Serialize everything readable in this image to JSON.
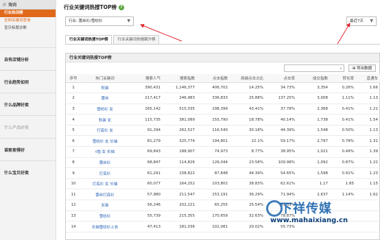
{
  "sidebar": {
    "header": "淘词",
    "sub_items": [
      {
        "label": "行业热词榜",
        "state": "active"
      },
      {
        "label": "全网关键词查询",
        "state": "orange"
      },
      {
        "label": "宝贝标题诊断",
        "state": "normal"
      }
    ],
    "sections": [
      {
        "label": "自有店铺分析",
        "dim": false
      },
      {
        "label": "行业趋势如何",
        "dim": false
      },
      {
        "label": "什么品牌好卖",
        "dim": false
      },
      {
        "label": "什么产品好卖",
        "dim": true
      },
      {
        "label": "谁家卖得好",
        "dim": false
      },
      {
        "label": "什么宝贝好卖",
        "dim": false
      }
    ]
  },
  "page": {
    "title": "行业关键词热搜TOP榜",
    "help_icon": "?",
    "industry_select": "行业: 蕾丝衫/雪纺衫",
    "period_select": "最近7天",
    "tabs": [
      {
        "label": "行业关键词热搜TOP榜",
        "active": true
      },
      {
        "label": "行业关键词热搜飙升榜",
        "active": false
      }
    ],
    "panel_title": "行业关键词热搜TOP榜",
    "search_placeholder": "",
    "export_label": "导出数据",
    "columns": [
      "序号",
      "热门关键词",
      "搜索人气",
      "搜索指数",
      "点击指数",
      "商城点击占比",
      "点击率",
      "成交指数",
      "转化率",
      "直通车"
    ]
  },
  "rows": [
    [
      "1",
      "秋装",
      "390,431",
      "1,146,377",
      "406,702",
      "14.25%",
      "34.73%",
      "3,354",
      "0.26%",
      "1.66"
    ],
    [
      "2",
      "蕾丝",
      "217,417",
      "246,983",
      "336,833",
      "25.88%",
      "137.25%",
      "3,008",
      "1.11%",
      "1.13"
    ],
    [
      "3",
      "雪纺衫 女",
      "165,142",
      "515,035",
      "198,399",
      "43.41%",
      "37.78%",
      "2,368",
      "0.41%",
      "1.21"
    ],
    [
      "4",
      "秋装 女",
      "115,735",
      "381,089",
      "155,790",
      "18.78%",
      "40.14%",
      "1,738",
      "0.41%",
      "1.54"
    ],
    [
      "5",
      "打底衫 女",
      "91,294",
      "262,527",
      "116,540",
      "30.18%",
      "44.39%",
      "1,548",
      "0.50%",
      "1.13"
    ],
    [
      "6",
      "雪纺衫 女 长袖",
      "81,279",
      "325,774",
      "194,801",
      "22.1%",
      "59.17%",
      "2,797",
      "0.78%",
      "1.31"
    ],
    [
      "7",
      "t恤 女 长袖",
      "69,843",
      "188,907",
      "74,973",
      "8.77%",
      "38.95%",
      "1,021",
      "0.49%",
      "1.39"
    ],
    [
      "8",
      "蕾丝衫",
      "68,847",
      "114,826",
      "126,044",
      "23.58%",
      "109.98%",
      "1,092",
      "0.87%",
      "1.22"
    ],
    [
      "9",
      "打底衫",
      "61,291",
      "158,822",
      "87,848",
      "44.39%",
      "54.65%",
      "1,598",
      "0.91%",
      "1.23"
    ],
    [
      "10",
      "打底衫 女 长袖",
      "60,077",
      "164,252",
      "103,802",
      "38.83%",
      "62.61%",
      "1,17",
      "1.85",
      "1.15"
    ],
    [
      "11",
      "蕾丝打底衫",
      "57,980",
      "211,547",
      "153,191",
      "36.29%",
      "71.94%",
      "2,637",
      "1.14%",
      "1.62"
    ],
    [
      "12",
      "女装",
      "56,246",
      "202,221",
      "65,255",
      "25.54%",
      "31.53%",
      "",
      "",
      ""
    ],
    [
      "13",
      "雪纺衫",
      "55,739",
      "215,355",
      "170,659",
      "32.63%",
      "78.87%",
      "",
      "",
      ""
    ],
    [
      "14",
      "长袖雪纺衫上衣",
      "47,413",
      "181,036",
      "102,081",
      "20.02%",
      "55.73%",
      "",
      "",
      ""
    ]
  ],
  "watermark": {
    "brand": "下祥传媒",
    "url": "www.mahaixiang.cn"
  },
  "colors": {
    "accent": "#e0691a",
    "link": "#2a63b6",
    "annotation": "#e0242a",
    "help": "#5aa43c"
  }
}
